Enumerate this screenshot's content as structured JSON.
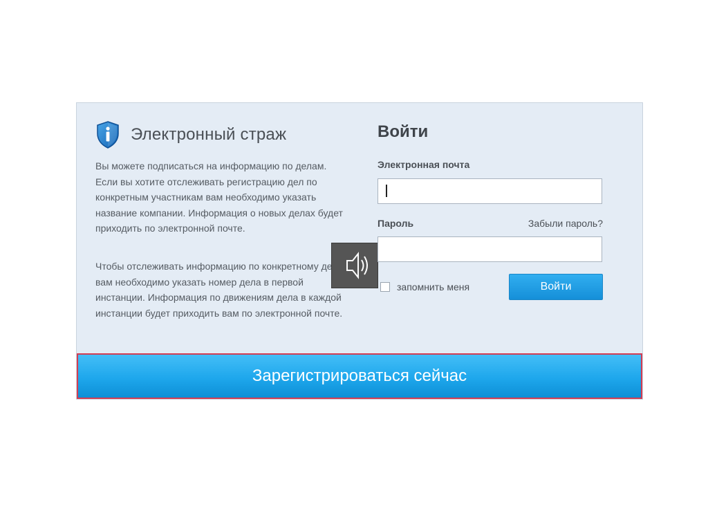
{
  "brand": {
    "title": "Электронный страж",
    "icon": "shield-info-icon"
  },
  "description": {
    "paragraph_1": "Вы можете подписаться на информацию по делам. Если вы хотите отслеживать регистрацию дел по конкретным участникам вам необходимо указать название компании. Информация о новых делах будет приходить по электронной почте.",
    "paragraph_2": "Чтобы отслеживать информацию по конкретному делу вам необходимо указать номер дела в первой инстанции. Информация по движениям дела в каждой инстанции будет приходить вам по электронной почте."
  },
  "login": {
    "title": "Войти",
    "email_label": "Электронная почта",
    "email_value": "",
    "password_label": "Пароль",
    "password_value": "",
    "forgot_link": "Забыли пароль?",
    "remember_label": "запомнить меня",
    "remember_checked": false,
    "submit_label": "Войти"
  },
  "register": {
    "label": "Зарегистрироваться сейчас"
  },
  "overlay": {
    "icon": "speaker-audio-icon"
  },
  "colors": {
    "panel_bg": "#e4ecf5",
    "button_blue": "#1ea7ec",
    "register_border": "#d23c52",
    "text": "#555b62"
  }
}
